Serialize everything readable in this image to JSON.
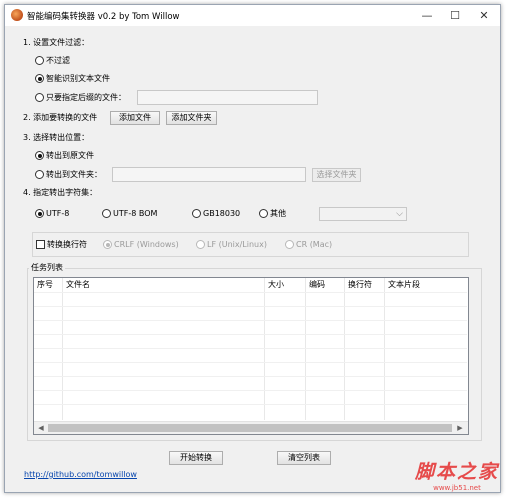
{
  "window": {
    "title": "智能编码集转换器 v0.2 by Tom Willow",
    "minimize": "—",
    "maximize": "☐",
    "close": "✕"
  },
  "filter": {
    "heading": "1. 设置文件过滤：",
    "options": [
      {
        "label": "不过滤",
        "checked": false
      },
      {
        "label": "智能识别文本文件",
        "checked": true
      },
      {
        "label": "只要指定后缀的文件：",
        "checked": false
      }
    ],
    "suffix_value": ""
  },
  "add": {
    "heading": "2. 添加要转换的文件",
    "add_file": "添加文件",
    "add_folder": "添加文件夹"
  },
  "output": {
    "heading": "3. 选择转出位置：",
    "options": [
      {
        "label": "转出到原文件",
        "checked": true
      },
      {
        "label": "转出到文件夹：",
        "checked": false
      }
    ],
    "folder_value": "",
    "choose_folder": "选择文件夹"
  },
  "charset": {
    "heading": "4. 指定转出字符集：",
    "options": [
      {
        "label": "UTF-8",
        "checked": true
      },
      {
        "label": "UTF-8 BOM",
        "checked": false
      },
      {
        "label": "GB18030",
        "checked": false
      },
      {
        "label": "其他",
        "checked": false
      }
    ],
    "other_value": ""
  },
  "newline": {
    "checkbox_label": "转换换行符",
    "checked": false,
    "options": [
      {
        "label": "CRLF (Windows)",
        "checked": true
      },
      {
        "label": "LF (Unix/Linux)",
        "checked": false
      },
      {
        "label": "CR (Mac)",
        "checked": false
      }
    ]
  },
  "tasks": {
    "heading": "任务列表",
    "columns": [
      "序号",
      "文件名",
      "大小",
      "编码",
      "换行符",
      "文本片段"
    ],
    "rows": [],
    "scroll_left": "◀",
    "scroll_right": "▶"
  },
  "actions": {
    "start": "开始转换",
    "clear": "清空列表"
  },
  "footer": {
    "link": "http://github.com/tomwillow"
  },
  "watermark": {
    "main": "脚本之家",
    "sub": "www.jb51.net"
  }
}
